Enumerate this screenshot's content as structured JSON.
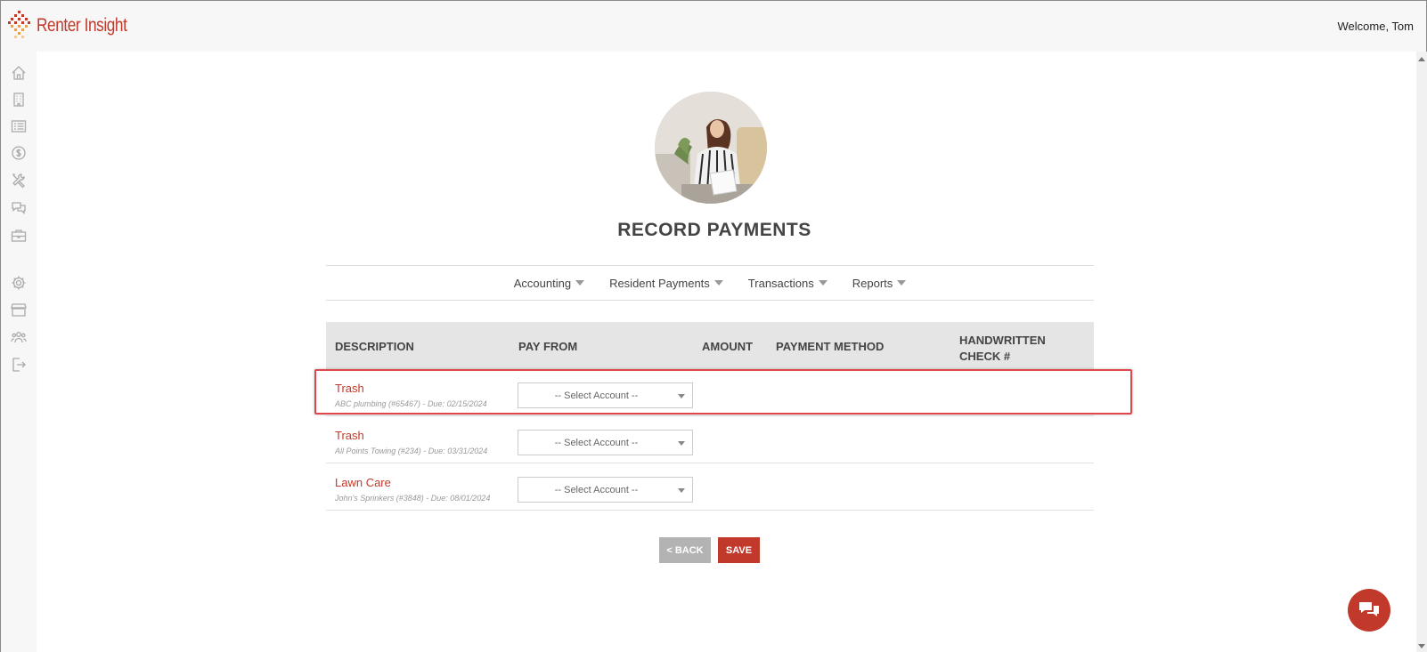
{
  "app": {
    "name": "Renter Insight",
    "welcome": "Welcome, Tom"
  },
  "page": {
    "title": "RECORD PAYMENTS"
  },
  "menu": [
    {
      "label": "Accounting"
    },
    {
      "label": "Resident Payments"
    },
    {
      "label": "Transactions"
    },
    {
      "label": "Reports"
    }
  ],
  "table": {
    "headers": {
      "description": "DESCRIPTION",
      "pay_from": "PAY FROM",
      "amount": "AMOUNT",
      "payment_method": "PAYMENT METHOD",
      "handwritten_line1": "HANDWRITTEN",
      "handwritten_line2": "CHECK #"
    },
    "rows": [
      {
        "title": "Trash",
        "subtitle": "ABC plumbing (#65467) - Due: 02/15/2024",
        "select": "-- Select Account --"
      },
      {
        "title": "Trash",
        "subtitle": "All Points Towing (#234) - Due: 03/31/2024",
        "select": "-- Select Account --"
      },
      {
        "title": "Lawn Care",
        "subtitle": "John's Sprinkers (#3848) - Due: 08/01/2024",
        "select": "-- Select Account --"
      }
    ]
  },
  "buttons": {
    "back": "< BACK",
    "save": "SAVE"
  },
  "help_icon_glyph": "?",
  "colors": {
    "brand": "#c0392b",
    "highlight": "#e0474c",
    "back_button": "#b3b3b3"
  },
  "sidebar_icons": [
    "home-icon",
    "building-icon",
    "list-icon",
    "dollar-icon",
    "tools-icon",
    "chat-icon",
    "briefcase-icon",
    "gear-icon",
    "store-icon",
    "users-icon",
    "logout-icon"
  ]
}
